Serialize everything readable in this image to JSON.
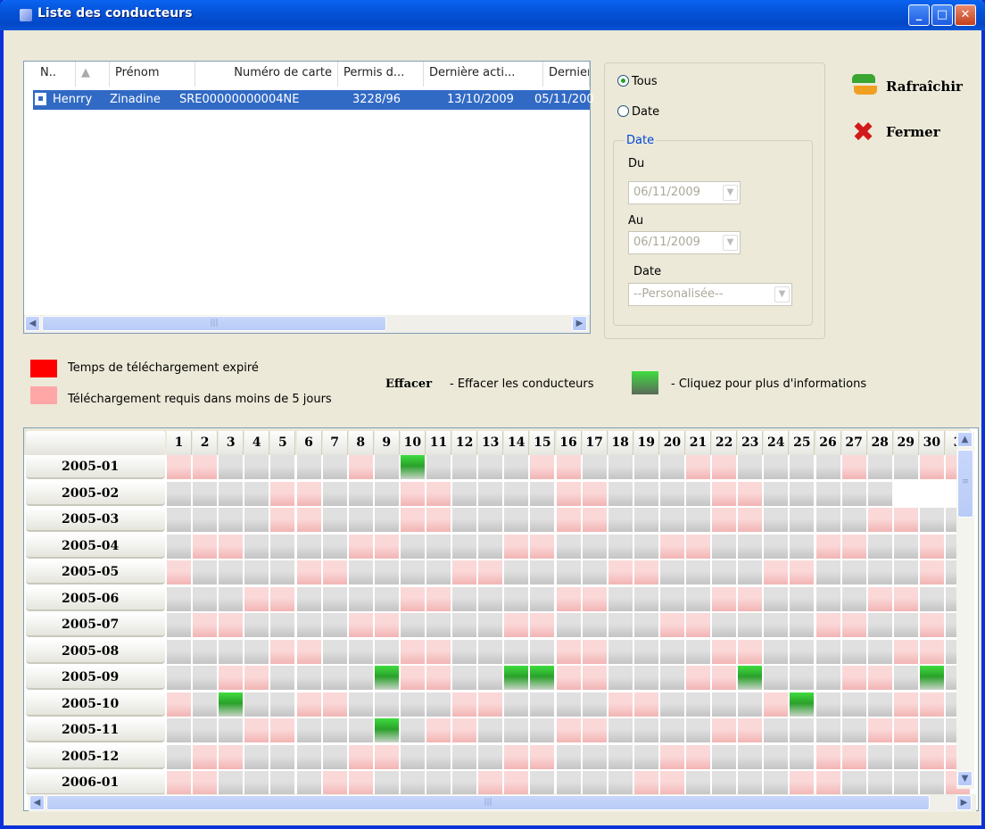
{
  "window": {
    "title": "Liste des conducteurs"
  },
  "list": {
    "columns": [
      "N..",
      "Prénom",
      "Numéro de carte",
      "Permis d...",
      "Dernière acti...",
      "Dernier .."
    ],
    "rows": [
      {
        "nom": "Henrry",
        "prenom": "Zinadine",
        "carte": "SRE00000000004NE",
        "permis": "3228/96",
        "derniere_activite": "13/10/2009",
        "dernier": "05/11/200"
      }
    ]
  },
  "filter": {
    "tous": "Tous",
    "date": "Date",
    "group": "Date",
    "du": "Du",
    "du_value": "06/11/2009",
    "au": "Au",
    "au_value": "06/11/2009",
    "date_label": "Date",
    "date_select": "--Personalisée--",
    "selected": "tous"
  },
  "actions": {
    "refresh": "Rafraîchir",
    "close": "Fermer"
  },
  "legend": {
    "expired": "Temps de téléchargement expiré",
    "soon": "Téléchargement requis dans moins de 5 jours",
    "effacer": "Effacer",
    "effacer_desc": "- Effacer les conducteurs",
    "click_desc": "- Cliquez pour plus d'informations"
  },
  "colors": {
    "expired": "#ff0000",
    "soon": "#ffa6a6",
    "downloaded": "#2fb22f",
    "normal": "#d2d2d2"
  },
  "calendar": {
    "days": [
      "1",
      "2",
      "3",
      "4",
      "5",
      "6",
      "7",
      "8",
      "9",
      "10",
      "11",
      "12",
      "13",
      "14",
      "15",
      "16",
      "17",
      "18",
      "19",
      "20",
      "21",
      "22",
      "23",
      "24",
      "25",
      "26",
      "27",
      "28",
      "29",
      "30",
      "3"
    ],
    "months": [
      {
        "label": "2005-01",
        "cells": "1100000102000011000011000010011"
      },
      {
        "label": "2005-02",
        "cells": "0000110001100001100001100000XXX"
      },
      {
        "label": "2005-03",
        "cells": "0000110001100001100001100001100"
      },
      {
        "label": "2005-04",
        "cells": "0110000110000110000110000110010"
      },
      {
        "label": "2005-05",
        "cells": "1000011000011000011000011000010"
      },
      {
        "label": "2005-06",
        "cells": "0001100001100001100001100001100"
      },
      {
        "label": "2005-07",
        "cells": "0110000110000110000110000110010"
      },
      {
        "label": "2005-08",
        "cells": "0000110001100001100001100000110"
      },
      {
        "label": "2005-09",
        "cells": "0011000021100221100011200011020"
      },
      {
        "label": "2005-10",
        "cells": "1020011000011000011000012000110"
      },
      {
        "label": "2005-11",
        "cells": "0001100020110001100001100001100"
      },
      {
        "label": "2005-12",
        "cells": "0110000110000110000110000110011"
      },
      {
        "label": "2006-01",
        "cells": "1100001100001100001100001100001"
      }
    ]
  }
}
